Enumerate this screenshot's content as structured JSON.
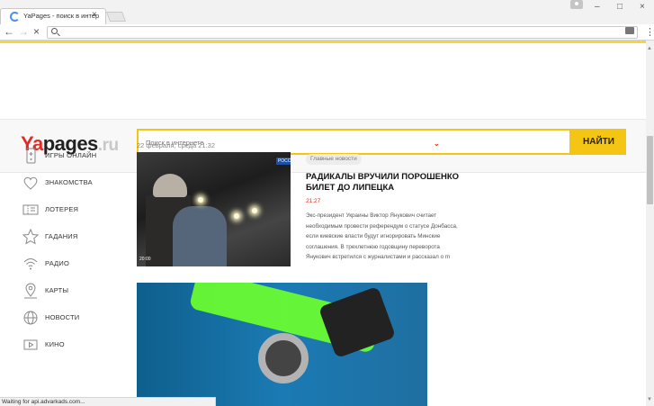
{
  "browser": {
    "tab_title": "YaPages - поиск в интер",
    "tab_close": "×",
    "address_value": "",
    "back": "←",
    "forward": "→",
    "reload_stop": "×",
    "menu": "⋮",
    "window_controls": {
      "minimize": "–",
      "maximize": "□",
      "close": "×"
    }
  },
  "header": {
    "logo": {
      "ya": "Ya",
      "pages": "pages",
      "ru": ".ru"
    },
    "search_placeholder": "Поиск в интернете",
    "search_button": "НАЙТИ"
  },
  "sidebar": {
    "items": [
      {
        "label": "ИГРЫ ОНЛАЙН",
        "icon": "gamepad-icon"
      },
      {
        "label": "ЗНАКОМСТВА",
        "icon": "heart-icon"
      },
      {
        "label": "ЛОТЕРЕЯ",
        "icon": "lottery-ticket-icon"
      },
      {
        "label": "ГАДАНИЯ",
        "icon": "star-icon"
      },
      {
        "label": "РАДИО",
        "icon": "radio-waves-icon"
      },
      {
        "label": "КАРТЫ",
        "icon": "map-pin-icon"
      },
      {
        "label": "НОВОСТИ",
        "icon": "globe-icon"
      },
      {
        "label": "КИНО",
        "icon": "play-icon"
      }
    ]
  },
  "news": {
    "date": "22 февраля, среда 21:32",
    "tag": "Главные новости",
    "headline": "РАДИКАЛЫ ВРУЧИЛИ ПОРОШЕНКО БИЛЕТ ДО ЛИПЕЦКА",
    "time": "21:27",
    "text": "Экс-президент Украины Виктор Янукович считает необходимым провести референдум о статусе Донбасса, если киевские власти будут игнорировать Минские соглашения. В трехлетнюю годовщину переворота Янукович встретился с журналистами и рассказал о m",
    "photo_logo": "РОССИЯ",
    "photo_time": "20:00"
  },
  "status_bar": "Waiting for api.advarkads.com...",
  "colors": {
    "brand_red": "#e32b22",
    "accent_yellow": "#f5c514"
  }
}
